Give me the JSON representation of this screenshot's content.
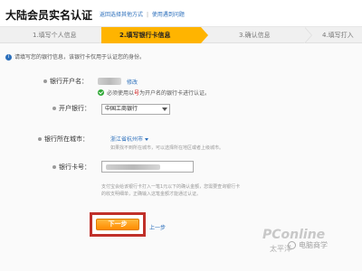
{
  "header": {
    "title": "大陆会员实名认证",
    "link_change": "返回选择其他方式",
    "separator": "|",
    "link_faq": "使用遇到问题"
  },
  "steps": [
    {
      "label": "1.填写个人信息"
    },
    {
      "label": "2.填写银行卡信息"
    },
    {
      "label": "3.确认信息"
    },
    {
      "label": "4.填写打入"
    }
  ],
  "notice": "请填写您的银行信息，该银行卡仅用于认证您的身份。",
  "form": {
    "account_name_label": "银行开户名：",
    "account_name_link": "修改",
    "account_name_note_prefix": "必须使用以",
    "account_name_note_highlight": "号",
    "account_name_note_suffix": "为开户名的银行卡进行认证。",
    "bank_label": "开户银行：",
    "bank_value": "中国工商银行",
    "city_label": "银行所在城市：",
    "city_value": "浙江省杭州市",
    "city_hint": "如果找不到所在城市，可以选择所在地区或者上级城市。",
    "card_label": "银行卡号：",
    "card_hint_1": "支付宝会给该银行卡打入一笔1元以下的确认金额，您需要查询银行卡",
    "card_hint_2": "的收支明细单，正确输入这笔金额才能通过认证。"
  },
  "buttons": {
    "next": "下一步",
    "prev": "上一步"
  },
  "watermark": {
    "big": "PConline",
    "small": "太平洋",
    "logo": "电脑商学"
  }
}
